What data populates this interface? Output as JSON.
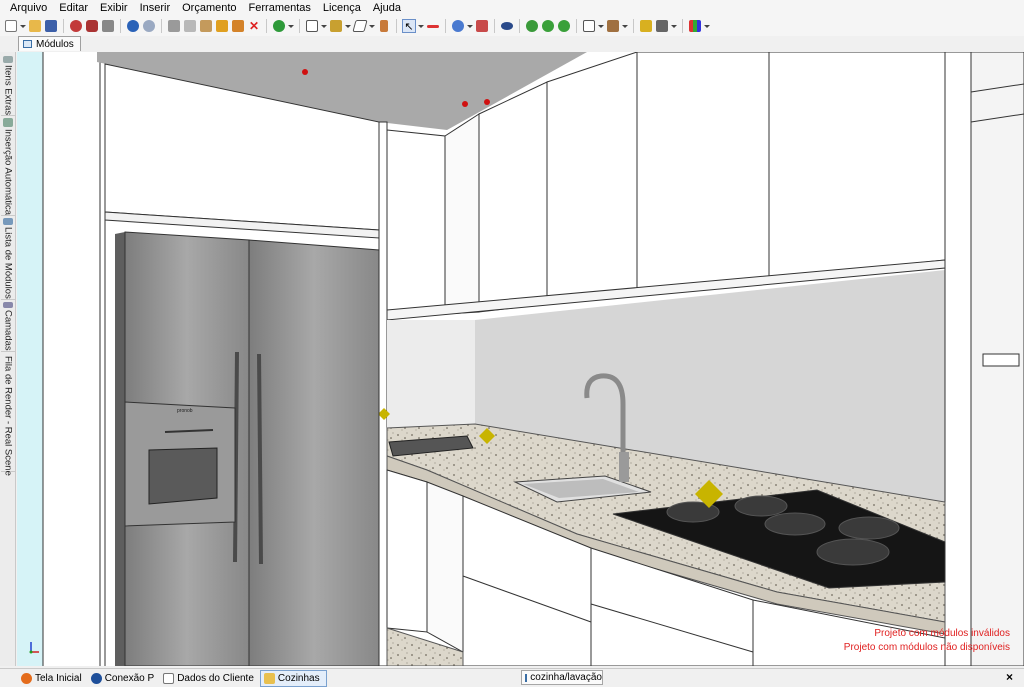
{
  "menu": {
    "items": [
      "Arquivo",
      "Editar",
      "Exibir",
      "Inserir",
      "Orçamento",
      "Ferramentas",
      "Licença",
      "Ajuda"
    ]
  },
  "toolbar": {
    "icons": [
      "new-file-icon",
      "open-folder-icon",
      "save-icon",
      "render-icon",
      "modules-icon",
      "print-icon",
      "undo-icon",
      "redo-icon",
      "cut-icon",
      "copy-icon",
      "paste-icon",
      "paint-icon",
      "hammer-icon",
      "delete-icon",
      "budget-icon",
      "rotate-icon",
      "measure-icon",
      "dimension-icon",
      "door-icon",
      "select-icon",
      "align-icon",
      "material-icon",
      "layout-icon",
      "eye-icon",
      "camera-icon",
      "back-icon",
      "forward-icon",
      "window-icon",
      "box-icon",
      "paint-bucket-icon",
      "screenshot-icon",
      "grid-icon"
    ]
  },
  "document_tab": {
    "label": "Módulos"
  },
  "side_tabs": [
    {
      "label": "Itens Extras",
      "icon": "items-icon"
    },
    {
      "label": "Inserção Automática",
      "icon": "auto-insert-icon"
    },
    {
      "label": "Lista de Módulos",
      "icon": "list-icon"
    },
    {
      "label": "Camadas",
      "icon": "layers-icon"
    },
    {
      "label": "Fila de Render - Real Scene",
      "icon": "render-queue-icon"
    }
  ],
  "viewport": {
    "warnings": [
      "Projeto com módulos inválidos",
      "Projeto com módulos não disponíveis"
    ],
    "hood_brand": "pronob",
    "fridge_brand": "pronob",
    "colors": {
      "wall": "#d8d8d8",
      "cabinet": "#ffffff",
      "outline": "#3a3a3a",
      "fridge": "#8e8e8e",
      "granite": "#d9d4c8",
      "cooktop": "#151515",
      "ceiling": "#a9a9a9",
      "marker": "#c8b400",
      "warning": "#e02020"
    }
  },
  "status_tabs": [
    {
      "label": "Tela Inicial",
      "icon": "home-icon"
    },
    {
      "label": "Conexão P",
      "icon": "connection-icon"
    },
    {
      "label": "Dados do Cliente",
      "icon": "document-icon"
    },
    {
      "label": "Cozinhas",
      "icon": "folder-icon",
      "active": true
    }
  ],
  "path_box": {
    "label": "cozinha/lavação"
  },
  "close_label": "×"
}
